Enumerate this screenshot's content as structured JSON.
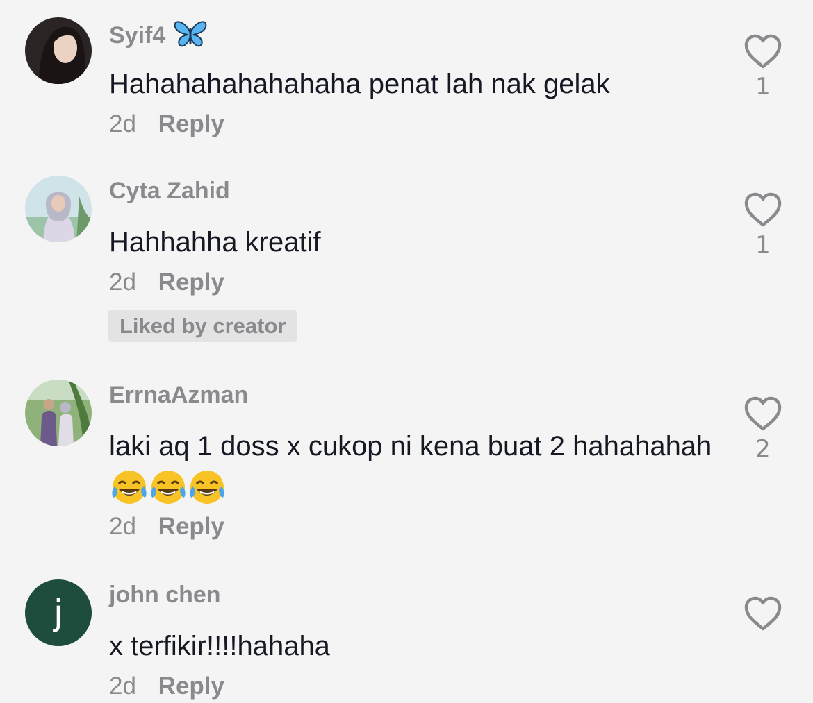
{
  "comments": [
    {
      "username": "Syif4",
      "username_emoji": "butterfly-emoji",
      "text": "Hahahahahahahaha penat lah nak gelak",
      "time": "2d",
      "reply_label": "Reply",
      "like_count": "1"
    },
    {
      "username": "Cyta Zahid",
      "text": "Hahhahha kreatif",
      "time": "2d",
      "reply_label": "Reply",
      "badge": "Liked by creator",
      "like_count": "1"
    },
    {
      "username": "ErrnaAzman",
      "text": "laki aq 1 doss x cukop ni kena buat 2 hahahahah",
      "text_emojis": [
        "face-with-tears-of-joy",
        "face-with-tears-of-joy",
        "face-with-tears-of-joy"
      ],
      "time": "2d",
      "reply_label": "Reply",
      "like_count": "2"
    },
    {
      "username": "john chen",
      "avatar_letter": "j",
      "avatar_color": "#1e4d3d",
      "text": "x terfikir!!!!hahaha",
      "time": "2d",
      "reply_label": "Reply",
      "like_count": ""
    }
  ],
  "icons": {
    "like": "heart-outline-icon"
  },
  "colors": {
    "background": "#f4f4f4",
    "text_primary": "#161823",
    "text_secondary": "#8a8a8e",
    "badge_background": "#e3e3e4"
  }
}
